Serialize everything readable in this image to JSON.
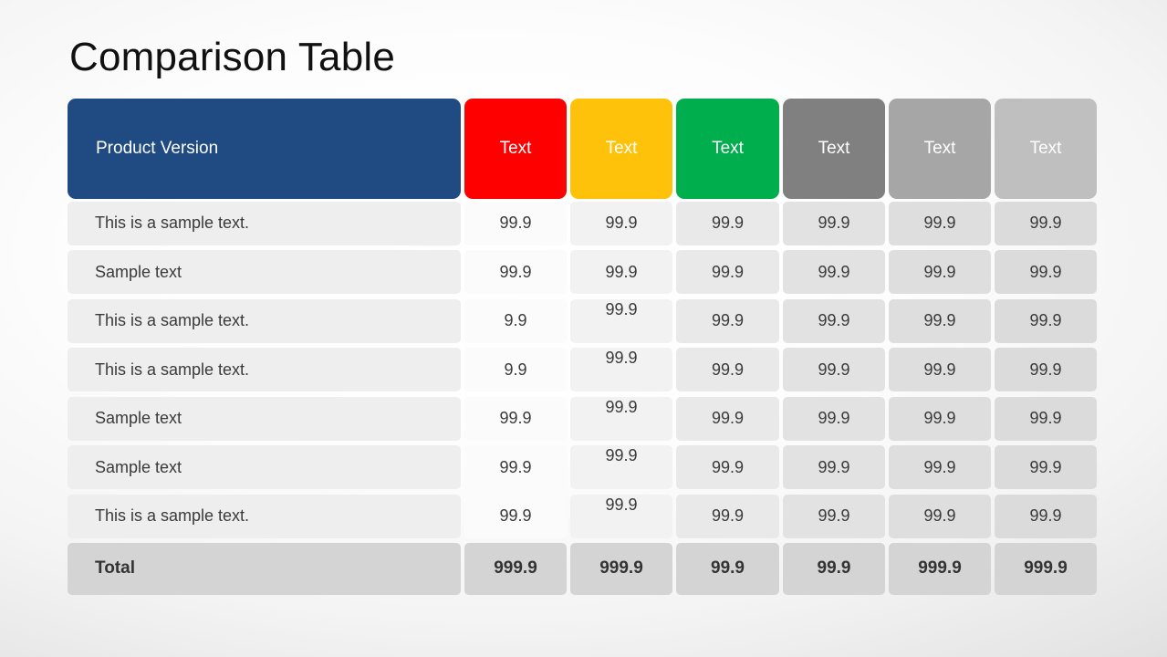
{
  "slide": {
    "title": "Comparison Table",
    "background_edge_color": "#dcdcdc",
    "background_center_color": "#ffffff"
  },
  "table": {
    "header": {
      "label": "Product Version",
      "label_bg": "#1f4b82",
      "columns": [
        {
          "label": "Text",
          "bg": "#ff0000"
        },
        {
          "label": "Text",
          "bg": "#ffc20a"
        },
        {
          "label": "Text",
          "bg": "#00ae4d"
        },
        {
          "label": "Text",
          "bg": "#808080"
        },
        {
          "label": "Text",
          "bg": "#a6a6a6"
        },
        {
          "label": "Text",
          "bg": "#bfbfbf"
        }
      ]
    },
    "rows": [
      {
        "label": "This is a sample text.",
        "values": [
          "99.9",
          "99.9",
          "99.9",
          "99.9",
          "99.9",
          "99.9"
        ]
      },
      {
        "label": "Sample text",
        "values": [
          "99.9",
          "99.9",
          "99.9",
          "99.9",
          "99.9",
          "99.9"
        ]
      },
      {
        "label": "This is a sample text.",
        "values": [
          "9.9",
          "99.9",
          "99.9",
          "99.9",
          "99.9",
          "99.9"
        ]
      },
      {
        "label": "This is a sample text.",
        "values": [
          "9.9",
          "99.9",
          "99.9",
          "99.9",
          "99.9",
          "99.9"
        ]
      },
      {
        "label": "Sample text",
        "values": [
          "99.9",
          "99.9",
          "99.9",
          "99.9",
          "99.9",
          "99.9"
        ]
      },
      {
        "label": "Sample text",
        "values": [
          "99.9",
          "99.9",
          "99.9",
          "99.9",
          "99.9",
          "99.9"
        ]
      },
      {
        "label": "This is a sample text.",
        "values": [
          "99.9",
          "99.9",
          "99.9",
          "99.9",
          "99.9",
          "99.9"
        ]
      }
    ],
    "total": {
      "label": "Total",
      "values": [
        "999.9",
        "999.9",
        "99.9",
        "99.9",
        "999.9",
        "999.9"
      ]
    }
  }
}
